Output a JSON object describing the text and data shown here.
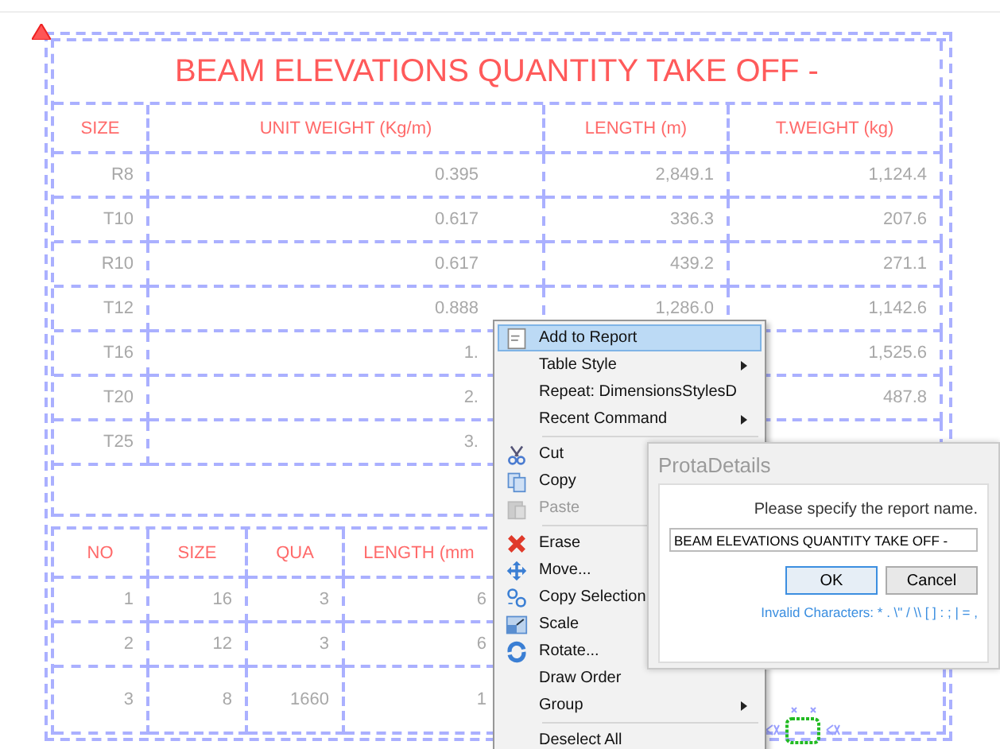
{
  "report_table": {
    "title": "BEAM ELEVATIONS QUANTITY TAKE OFF -",
    "columns": [
      "SIZE",
      "UNIT WEIGHT (Kg/m)",
      "LENGTH (m)",
      "T.WEIGHT (kg)"
    ],
    "rows": [
      [
        "R8",
        "0.395",
        "2,849.1",
        "1,124.4"
      ],
      [
        "T10",
        "0.617",
        "336.3",
        "207.6"
      ],
      [
        "R10",
        "0.617",
        "439.2",
        "271.1"
      ],
      [
        "T12",
        "0.888",
        "1,286.0",
        "1,142.6"
      ],
      [
        "T16",
        "1.",
        null,
        "1,525.6"
      ],
      [
        "T20",
        "2.",
        null,
        "487.8"
      ],
      [
        "T25",
        "3.",
        null,
        null
      ]
    ]
  },
  "detail_table": {
    "columns": [
      "NO",
      "SIZE",
      "QUA",
      "LENGTH (mm"
    ],
    "rows": [
      [
        "1",
        "16",
        "3",
        "6"
      ],
      [
        "2",
        "12",
        "3",
        "6"
      ],
      [
        "3",
        "8",
        "1660",
        "1"
      ]
    ]
  },
  "context_menu": {
    "items": [
      {
        "kind": "item",
        "label": "Add to Report",
        "selected": true,
        "disabled": false
      },
      {
        "kind": "submenu",
        "label": "Table Style",
        "selected": false,
        "disabled": false
      },
      {
        "kind": "item",
        "label": "Repeat: DimensionsStylesD",
        "selected": false,
        "disabled": false
      },
      {
        "kind": "submenu",
        "label": "Recent Command",
        "selected": false,
        "disabled": false
      },
      {
        "kind": "separator"
      },
      {
        "kind": "item",
        "label": "Cut",
        "selected": false,
        "disabled": false
      },
      {
        "kind": "item",
        "label": "Copy",
        "selected": false,
        "disabled": false
      },
      {
        "kind": "item",
        "label": "Paste",
        "selected": false,
        "disabled": true
      },
      {
        "kind": "separator"
      },
      {
        "kind": "item",
        "label": "Erase",
        "selected": false,
        "disabled": false
      },
      {
        "kind": "item",
        "label": "Move...",
        "selected": false,
        "disabled": false
      },
      {
        "kind": "item",
        "label": "Copy Selection",
        "selected": false,
        "disabled": false
      },
      {
        "kind": "item",
        "label": "Scale",
        "selected": false,
        "disabled": false
      },
      {
        "kind": "item",
        "label": "Rotate...",
        "selected": false,
        "disabled": false
      },
      {
        "kind": "item",
        "label": "Draw Order",
        "selected": false,
        "disabled": false
      },
      {
        "kind": "submenu",
        "label": "Group",
        "selected": false,
        "disabled": false
      },
      {
        "kind": "separator"
      },
      {
        "kind": "item",
        "label": "Deselect All",
        "selected": false,
        "disabled": false
      }
    ]
  },
  "dialog": {
    "title": "ProtaDetails",
    "prompt": "Please specify the report name.",
    "value": "BEAM ELEVATIONS QUANTITY TAKE OFF -",
    "buttons": [
      {
        "label": "OK",
        "default": true
      },
      {
        "label": "Cancel",
        "default": false
      }
    ],
    "note": "Invalid Characters: * . \\\" / \\\\ [ ] : ; | = ,"
  }
}
